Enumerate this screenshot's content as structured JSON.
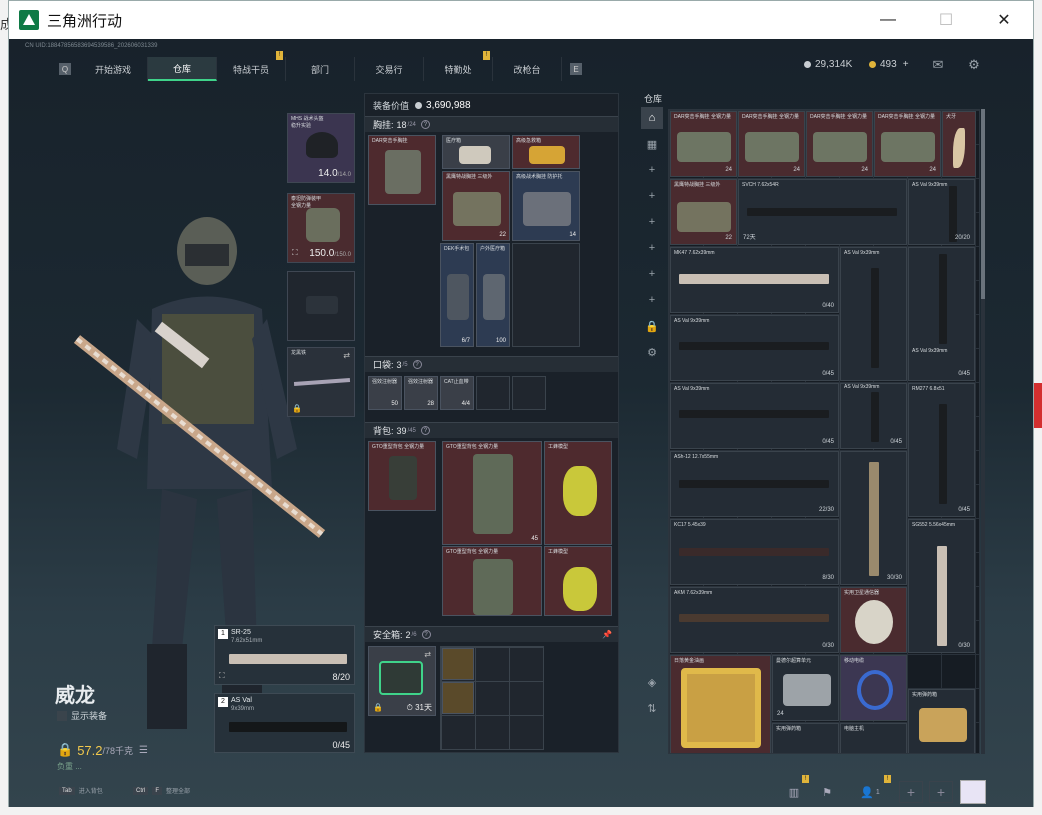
{
  "window": {
    "title": "三角洲行动",
    "buttons": [
      "—",
      "☐",
      "✕"
    ]
  },
  "uid": "CN UID:18847856583694539586_202606031339",
  "nav": {
    "left_key": "Q",
    "right_key": "E",
    "tabs": [
      {
        "label": "开始游戏",
        "badge": false
      },
      {
        "label": "仓库",
        "badge": false,
        "active": true
      },
      {
        "label": "特战干员",
        "badge": true
      },
      {
        "label": "部门",
        "badge": false
      },
      {
        "label": "交易行",
        "badge": false
      },
      {
        "label": "特勤处",
        "badge": true
      },
      {
        "label": "改枪台",
        "badge": false
      }
    ],
    "badge_text": "!"
  },
  "currency": {
    "coins": "29,314K",
    "tickets": "493",
    "plus": "+"
  },
  "operator": {
    "name": "威龙",
    "toggle_label": "显示装备",
    "weight": "57.2",
    "weight_max": "/78千克",
    "tip": "负重 ..."
  },
  "equipment": {
    "helmet": {
      "label": "MHS 战术头盔",
      "sub": "稳升实验",
      "durability": "14.0",
      "max": "/14.0"
    },
    "armor": {
      "label": "泰坦防弹装甲",
      "sub": "全钢力量",
      "durability": "150.0",
      "max": "/150.0"
    },
    "melee": {
      "label": "龙黑铁"
    },
    "weapon1": {
      "num": "1",
      "name": "SR-25",
      "caliber": "7.62x51mm",
      "ammo": "8/20"
    },
    "weapon2": {
      "num": "2",
      "name": "AS Val",
      "caliber": "9x39mm",
      "ammo": "0/45"
    }
  },
  "middle": {
    "value_label": "装备价值",
    "value": "3,690,988",
    "chest": {
      "label": "胸挂",
      "count": "18",
      "max": "/24"
    },
    "pocket": {
      "label": "口袋",
      "count": "3",
      "max": "/5"
    },
    "backpack": {
      "label": "背包",
      "count": "39",
      "max": "/45"
    },
    "safe": {
      "label": "安全箱",
      "count": "2",
      "max": "/6",
      "days": "31天"
    },
    "items": {
      "rig": "DAR突击手胸挂",
      "i1": "医疗箱",
      "i2": "高级急救箱",
      "i3": "黑鹰特战胸挂 三级外",
      "i4": "高级战术胸挂 防护托",
      "i3c": "22",
      "i4c": "14",
      "i5": "DEK手术包",
      "i6": "户外医疗箱",
      "i5c": "6/7",
      "i6c": "100",
      "p1": "强效注射器",
      "p2": "强效注射器",
      "p3": "CAT止血带",
      "p1c": "50",
      "p2c": "28",
      "p3c": "4/4",
      "bp": "GTO重型背包 全钢力量",
      "b1": "GTO重型背包 全钢力量",
      "b2": "工蜂模型",
      "b1c": "45",
      "b3": "GTO重型背包 全钢力量",
      "b4": "工蜂模型"
    }
  },
  "warehouse": {
    "title": "仓库",
    "items": [
      {
        "label": "DAR突击手胸挂 全钢力量",
        "count": "24"
      },
      {
        "label": "DAR突击手胸挂 全钢力量",
        "count": "24"
      },
      {
        "label": "DAR突击手胸挂 全钢力量",
        "count": "24"
      },
      {
        "label": "DAR突击手胸挂 全钢力量",
        "count": "24"
      },
      {
        "label": "犬牙"
      },
      {
        "label": "黑鹰特战胸挂 三级外",
        "count": "22"
      },
      {
        "label": "SVCH 7.62x54R",
        "count": "72天"
      },
      {
        "label": "AS Val 9x39mm",
        "ammo": "20/20"
      },
      {
        "label": "MK47 7.62x39mm",
        "ammo": "0/40"
      },
      {
        "label": "AS Val 9x39mm"
      },
      {
        "label": "AS Val 9x39mm",
        "ammo": "0/45"
      },
      {
        "label": "AS Val 9x39mm",
        "ammo": "0/45"
      },
      {
        "label": "AS Val 9x39mm",
        "ammo": "0/45"
      },
      {
        "label": "AS Val 9x39mm",
        "ammo": "0/45"
      },
      {
        "label": "RM277 6.8x51",
        "ammo": "0/45"
      },
      {
        "label": "ASh-12 12.7x55mm",
        "ammo": "22/30"
      },
      {
        "label": "KC17 5.45x39",
        "ammo": "8/30"
      },
      {
        "label": "SG552 5.56x45mm",
        "ammo": "30/30"
      },
      {
        "label": "AKM 7.62x39mm",
        "ammo": "0/30"
      },
      {
        "label": "实用卫星通信器"
      },
      {
        "label": "日落黄金油画"
      },
      {
        "label": "曼德尔超算单元",
        "count": "24"
      },
      {
        "label": "移动电缆"
      },
      {
        "label": "实用弹药箱"
      },
      {
        "label": "实用弹药箱"
      },
      {
        "label": "电脑主机"
      }
    ],
    "extra_ammo": "0/30"
  },
  "footer": {
    "hint1_key": "Tab",
    "hint1": "进入背包",
    "hint2_key": "Ctrl",
    "hint2_key2": "F",
    "hint2": "整理全部",
    "party_count": "1"
  },
  "colors": {
    "accent": "#3fd38a",
    "badge": "#e0b43a",
    "red": "#d32f2f"
  }
}
